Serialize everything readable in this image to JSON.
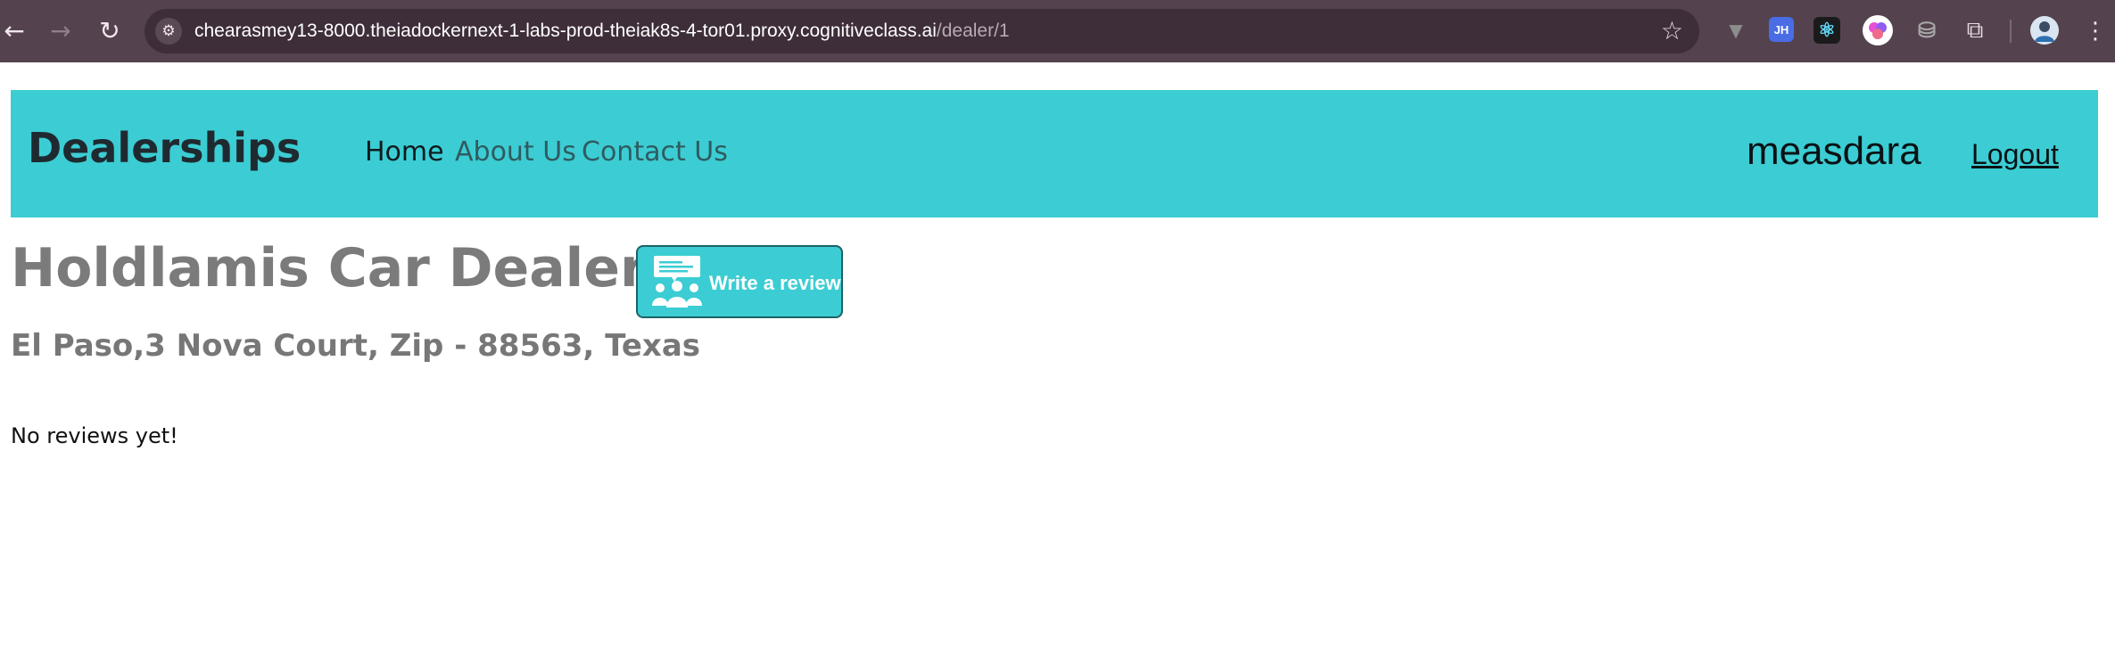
{
  "browser": {
    "url_host": "chearasmey13-8000.theiadockernext-1-labs-prod-theiak8s-4-tor01.proxy.cognitiveclass.ai",
    "url_path": "/dealer/1",
    "back_icon": "←",
    "forward_icon": "→",
    "reload_icon": "↻",
    "site_info_icon": "⚙",
    "bookmark_icon": "☆",
    "extensions": [
      {
        "name": "vue-devtools-icon",
        "glyph": "▼",
        "color": "#8d8d8d"
      },
      {
        "name": "jh-extension-icon",
        "glyph": "JH",
        "color": "#4a6de5"
      },
      {
        "name": "react-devtools-icon",
        "glyph": "⚛",
        "color": "#1b1b1b"
      },
      {
        "name": "colorful-extension-icon",
        "glyph": "●",
        "color": "#ffffff"
      },
      {
        "name": "storage-extension-icon",
        "glyph": "⛁",
        "color": "#9b9b9b"
      },
      {
        "name": "extensions-puzzle-icon",
        "glyph": "⧉",
        "color": "#e9dde6"
      }
    ],
    "menu_icon": "⋮"
  },
  "navbar": {
    "brand": "Dealerships",
    "links": [
      "Home",
      "About Us",
      "Contact Us"
    ],
    "active_link": "Home",
    "username": "measdara",
    "logout": "Logout",
    "background": "#3bcdd3"
  },
  "dealer": {
    "title": "Holdlamis Car Dealership",
    "address": "El Paso,3 Nova Court, Zip - 88563, Texas",
    "review_button_label": "Write a review",
    "empty_reviews": "No reviews yet!"
  }
}
